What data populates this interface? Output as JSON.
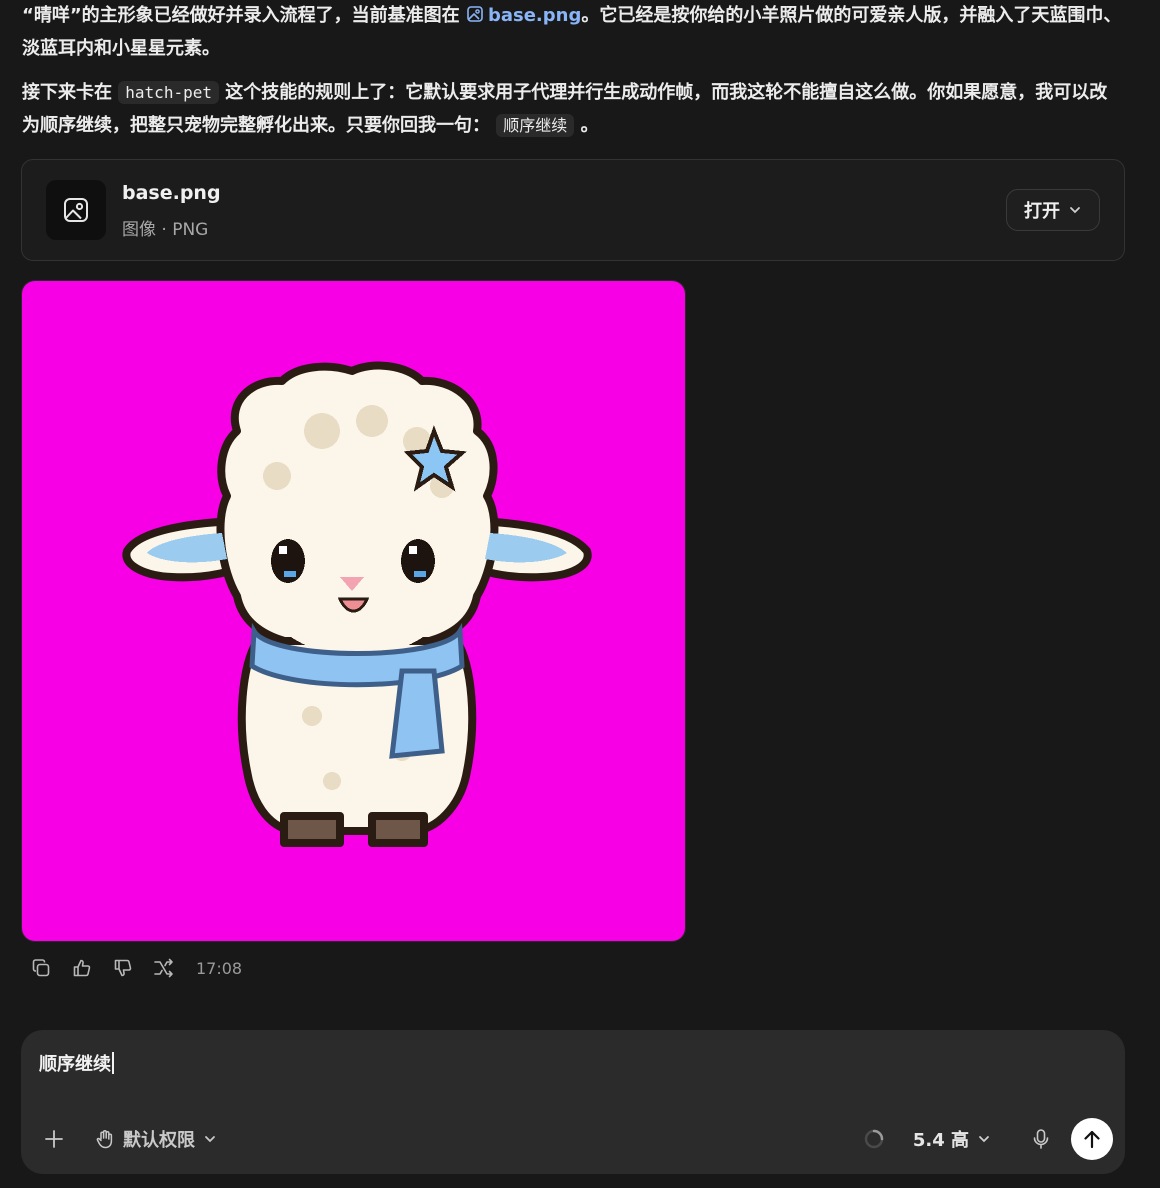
{
  "message": {
    "p1_a": "“晴咩”的主形象已经做好并录入流程了，当前基准图在",
    "p1_link": "base.png",
    "p1_b": "。它已经是按你给的小羊照片做的可爱亲人版，并融入了天蓝围巾、淡蓝耳内和小星星元素。",
    "p2_a": "接下来卡在",
    "p2_code": "hatch-pet",
    "p2_b": "这个技能的规则上了：它默认要求用子代理并行生成动作帧，而我这轮不能擅自这么做。你如果愿意，我可以改为顺序继续，把整只宠物完整孵化出来。只要你回我一句：",
    "p2_code2": "顺序继续",
    "p2_c": "。"
  },
  "file_card": {
    "name": "base.png",
    "meta": "图像 · PNG",
    "open_label": "打开",
    "icon": "image-icon"
  },
  "preview": {
    "background": "#f700e6",
    "wool": "#fbf6e9",
    "wool_shade": "#e9dcc4",
    "scarf": "#8fc3f2",
    "ear_inner": "#9ccbf0",
    "star": "#8cc6f5"
  },
  "actions": {
    "icons": [
      "copy-icon",
      "thumbs-up-icon",
      "thumbs-down-icon",
      "share-icon"
    ],
    "timestamp": "17:08"
  },
  "composer": {
    "input_text": "顺序继续",
    "permission_label": "默认权限",
    "model_label": "5.4 高"
  },
  "colors": {
    "background": "#181818",
    "link": "#8ab4f8",
    "composer_bg": "#2b2b2b"
  }
}
